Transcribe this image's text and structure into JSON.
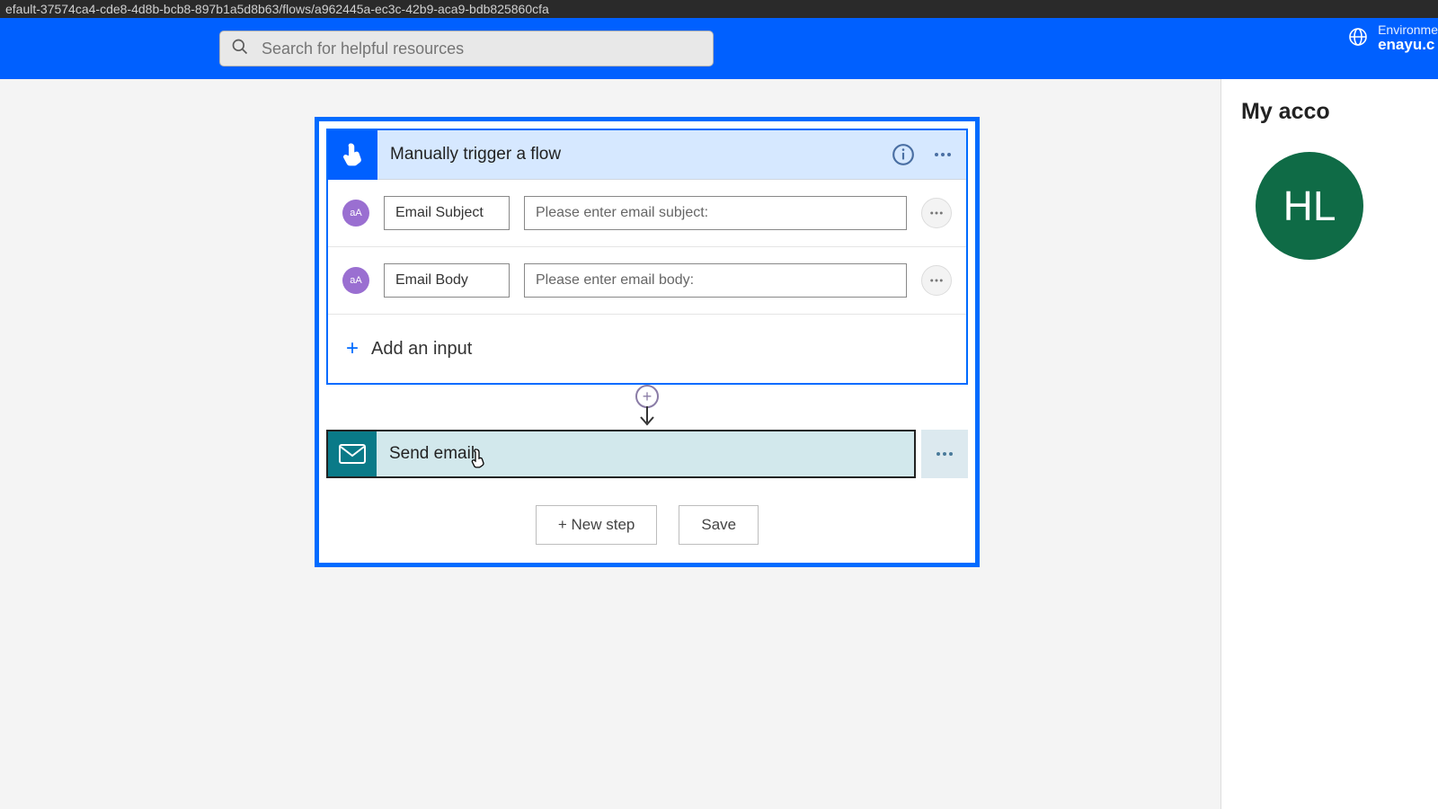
{
  "url_fragment": "efault-37574ca4-cde8-4d8b-bcb8-897b1a5d8b63/flows/a962445a-ec3c-42b9-aca9-bdb825860cfa",
  "search": {
    "placeholder": "Search for helpful resources"
  },
  "env": {
    "label": "Environme",
    "value": "enayu.c"
  },
  "account": {
    "heading": "My acco",
    "avatar_initials": "HL"
  },
  "trigger": {
    "title": "Manually trigger a flow",
    "params": [
      {
        "badge": "aA",
        "name": "Email Subject",
        "placeholder": "Please enter email subject:"
      },
      {
        "badge": "aA",
        "name": "Email Body",
        "placeholder": "Please enter email body:"
      }
    ],
    "add_input_label": "Add an input"
  },
  "action": {
    "title": "Send email"
  },
  "footer": {
    "new_step": "+ New step",
    "save": "Save"
  }
}
